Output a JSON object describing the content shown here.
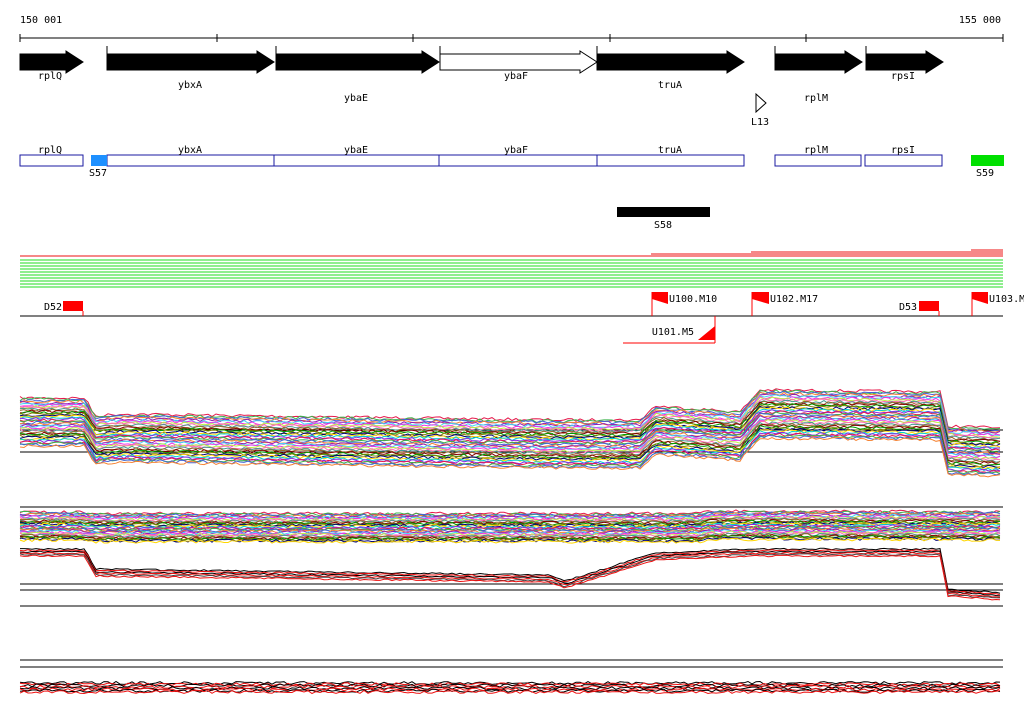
{
  "ruler": {
    "start_label": "150 001",
    "end_label": "155 000"
  },
  "genes": [
    {
      "name": "rplQ",
      "strand": "+",
      "filled": true
    },
    {
      "name": "ybxA",
      "strand": "+",
      "filled": true
    },
    {
      "name": "ybaE",
      "strand": "+",
      "filled": true
    },
    {
      "name": "ybaF",
      "strand": "+",
      "filled": false
    },
    {
      "name": "truA",
      "strand": "+",
      "filled": true
    },
    {
      "name": "rplM",
      "strand": "+",
      "filled": true
    },
    {
      "name": "rpsI",
      "strand": "+",
      "filled": true
    }
  ],
  "small_feature": {
    "name": "L13"
  },
  "boxes": [
    {
      "name": "rplQ"
    },
    {
      "name": "ybxA"
    },
    {
      "name": "ybaE"
    },
    {
      "name": "ybaF"
    },
    {
      "name": "truA"
    },
    {
      "name": "rplM"
    },
    {
      "name": "rpsI"
    }
  ],
  "segments": [
    {
      "name": "S57",
      "color": "#1e90ff"
    },
    {
      "name": "S59",
      "color": "#00e000"
    },
    {
      "name": "S58",
      "color": "#000000"
    }
  ],
  "markers": [
    {
      "name": "D52",
      "kind": "block"
    },
    {
      "name": "U100.M10",
      "kind": "flag"
    },
    {
      "name": "U102.M17",
      "kind": "flag"
    },
    {
      "name": "D53",
      "kind": "block"
    },
    {
      "name": "U103.M",
      "kind": "flag"
    },
    {
      "name": "U101.M5",
      "kind": "flag-reverse"
    }
  ],
  "colors": {
    "gene_fill": "#000000",
    "box_stroke": "#1a1aa0",
    "marker": "#ff0000",
    "green_track": "#22dd22",
    "red_track": "#ee1111"
  },
  "signal_palette": [
    "#e6194b",
    "#3cb44b",
    "#4363d8",
    "#f58231",
    "#911eb4",
    "#42d4f4",
    "#f032e6",
    "#bfef45",
    "#ff69b4",
    "#469990",
    "#9a6324",
    "#800000",
    "#00a000",
    "#808000",
    "#000075",
    "#ffd700",
    "#00ced1",
    "#8a2be2"
  ]
}
